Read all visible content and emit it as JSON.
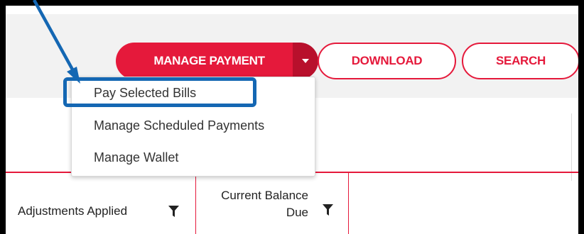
{
  "toolbar": {
    "manage_payment_label": "MANAGE PAYMENT",
    "download_label": "DOWNLOAD",
    "search_label": "SEARCH"
  },
  "dropdown": {
    "items": [
      {
        "label": "Pay Selected Bills",
        "highlighted": true
      },
      {
        "label": "Manage Scheduled Payments"
      },
      {
        "label": "Manage Wallet"
      }
    ]
  },
  "table": {
    "headers": [
      "Adjustments Applied",
      "Current Balance Due"
    ],
    "header_current_line1": "Current Balance",
    "header_current_line2": "Due"
  },
  "colors": {
    "accent": "#e5193b",
    "accent_dark": "#b8102c",
    "annotation": "#1467b3"
  },
  "icons": [
    "chevron-down-icon",
    "filter-icon",
    "annotation-arrow-icon"
  ]
}
